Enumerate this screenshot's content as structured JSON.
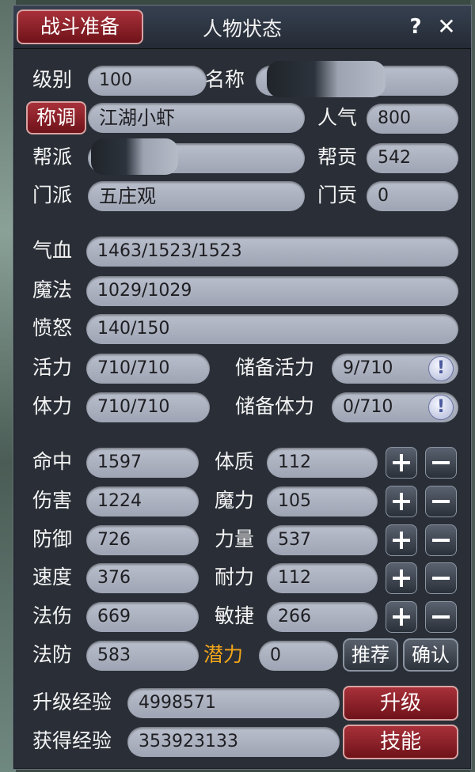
{
  "header": {
    "battle_btn": "战斗准备",
    "title": "人物状态",
    "help_icon": "?",
    "close_icon": "✕"
  },
  "profile": {
    "level_label": "级别",
    "level": "100",
    "name_label": "名称",
    "name": "",
    "title_btn": "称调",
    "title_value": "江湖小虾",
    "pop_label": "人气",
    "pop": "800",
    "gang_label": "帮派",
    "gang": "",
    "contrib_label": "帮贡",
    "contrib": "542",
    "sect_label": "门派",
    "sect": "五庄观",
    "sect_contrib_label": "门贡",
    "sect_contrib": "0"
  },
  "vitals": {
    "hp_label": "气血",
    "hp": "1463/1523/1523",
    "mp_label": "魔法",
    "mp": "1029/1029",
    "anger_label": "愤怒",
    "anger": "140/150",
    "vigor_label": "活力",
    "vigor": "710/710",
    "res_vigor_label": "储备活力",
    "res_vigor": "9/710",
    "stamina_label": "体力",
    "stamina": "710/710",
    "res_stamina_label": "储备体力",
    "res_stamina": "0/710"
  },
  "stats": {
    "left": [
      {
        "label": "命中",
        "value": "1597"
      },
      {
        "label": "伤害",
        "value": "1224"
      },
      {
        "label": "防御",
        "value": "726"
      },
      {
        "label": "速度",
        "value": "376"
      },
      {
        "label": "法伤",
        "value": "669"
      },
      {
        "label": "法防",
        "value": "583"
      }
    ],
    "right": [
      {
        "label": "体质",
        "value": "112"
      },
      {
        "label": "魔力",
        "value": "105"
      },
      {
        "label": "力量",
        "value": "537"
      },
      {
        "label": "耐力",
        "value": "112"
      },
      {
        "label": "敏捷",
        "value": "266"
      }
    ],
    "potential_label": "潜力",
    "potential": "0",
    "recommend_btn": "推荐",
    "confirm_btn": "确认"
  },
  "exp": {
    "upgrade_label": "升级经验",
    "upgrade": "4998571",
    "gained_label": "获得经验",
    "gained": "353923133",
    "levelup_btn": "升级",
    "skills_btn": "技能"
  },
  "colors": {
    "accent_red": "#8a1f27",
    "potential_orange": "#f2a51a",
    "field": "#b1b7c4"
  }
}
